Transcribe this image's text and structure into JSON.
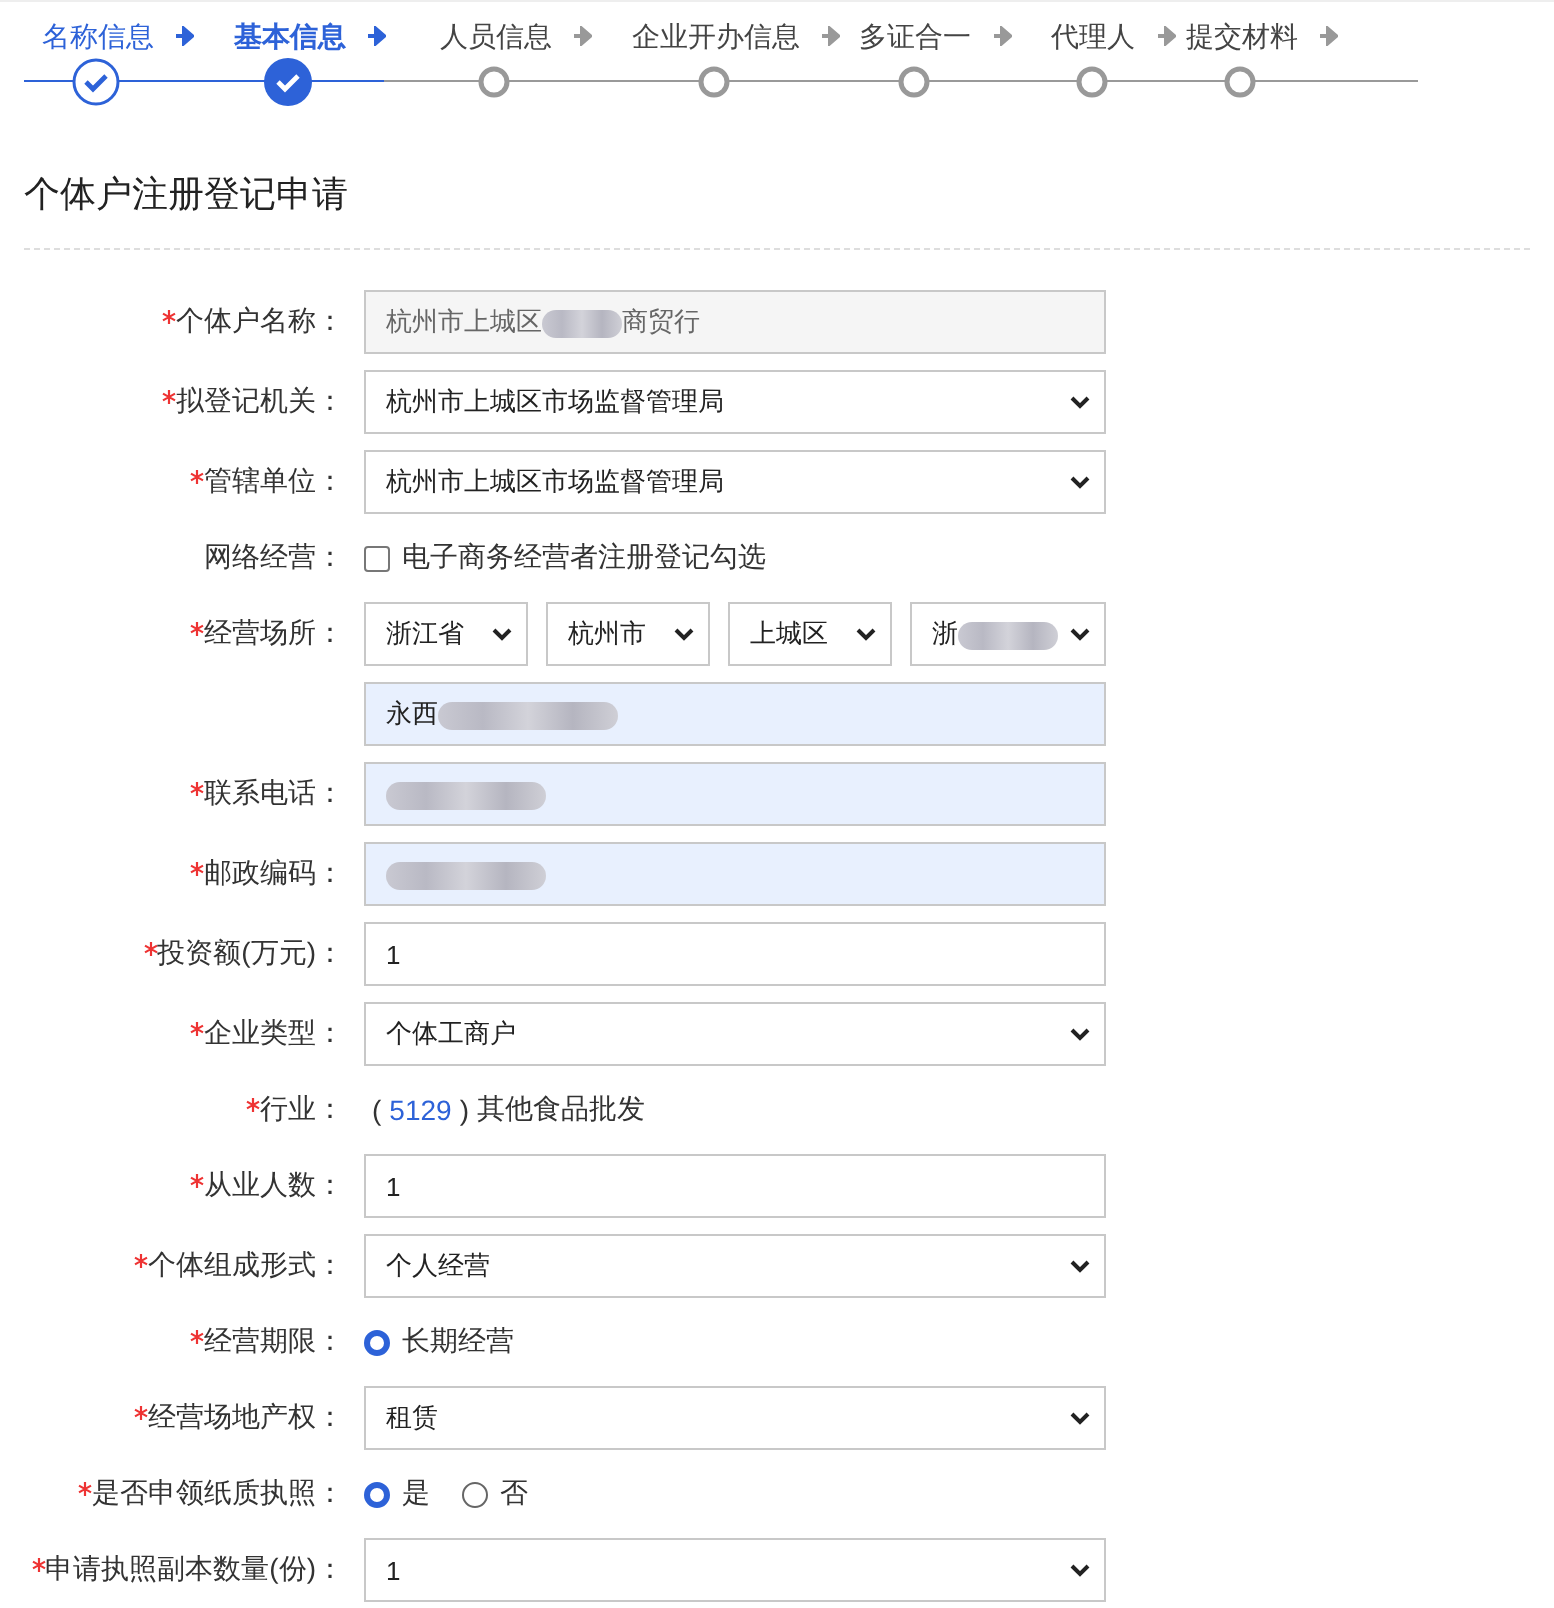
{
  "steps": [
    {
      "label": "名称信息",
      "completed": true,
      "selected": false
    },
    {
      "label": "基本信息",
      "completed": true,
      "selected": true
    },
    {
      "label": "人员信息",
      "completed": false,
      "selected": false
    },
    {
      "label": "企业开办信息",
      "completed": false,
      "selected": false
    },
    {
      "label": "多证合一",
      "completed": false,
      "selected": false
    },
    {
      "label": "代理人",
      "completed": false,
      "selected": false
    },
    {
      "label": "提交材料",
      "completed": false,
      "selected": false
    }
  ],
  "title": "个体户注册登记申请",
  "rows": [
    {
      "kind": "readonly",
      "label": "个体户名称：",
      "required": true,
      "value": "杭州市上城区",
      "redacted": true,
      "value_tail": "商贸行"
    },
    {
      "kind": "select",
      "label": "拟登记机关：",
      "required": true,
      "value": "杭州市上城区市场监督管理局"
    },
    {
      "kind": "select",
      "label": "管辖单位：",
      "required": true,
      "value": "杭州市上城区市场监督管理局"
    },
    {
      "kind": "checkbox",
      "label": "网络经营：",
      "required": false,
      "option": "电子商务经营者注册登记勾选",
      "checked": false
    },
    {
      "kind": "region",
      "label": "经营场所：",
      "required": true,
      "selects": [
        {
          "value": "浙江省",
          "redacted": false
        },
        {
          "value": "杭州市",
          "redacted": false
        },
        {
          "value": "上城区",
          "redacted": false
        },
        {
          "value": "浙",
          "redacted": true
        }
      ]
    },
    {
      "kind": "filled",
      "value": "永西",
      "redacted": true
    },
    {
      "kind": "filled",
      "label": "联系电话：",
      "required": true,
      "redacted": true
    },
    {
      "kind": "filled",
      "label": "邮政编码：",
      "required": true,
      "redacted": true
    },
    {
      "kind": "input",
      "label": "投资额(万元)：",
      "required": true,
      "value": "1"
    },
    {
      "kind": "select",
      "label": "企业类型：",
      "required": true,
      "value": "个体工商户"
    },
    {
      "kind": "code",
      "label": "行业：",
      "required": true,
      "open": "(",
      "code": "5129",
      "close": ")",
      "value": "其他食品批发"
    },
    {
      "kind": "input",
      "label": "从业人数：",
      "required": true,
      "value": "1"
    },
    {
      "kind": "select",
      "label": "个体组成形式：",
      "required": true,
      "value": "个人经营"
    },
    {
      "kind": "radio",
      "label": "经营期限：",
      "required": true,
      "options": [
        {
          "label": "长期经营",
          "selected": true
        }
      ]
    },
    {
      "kind": "select",
      "label": "经营场地产权：",
      "required": true,
      "value": "租赁"
    },
    {
      "kind": "radio",
      "label": "是否申领纸质执照：",
      "required": true,
      "options": [
        {
          "label": "是",
          "selected": true
        },
        {
          "label": "否",
          "selected": false
        }
      ]
    },
    {
      "kind": "select",
      "label": "申请执照副本数量(份)：",
      "required": true,
      "value": "1"
    }
  ]
}
